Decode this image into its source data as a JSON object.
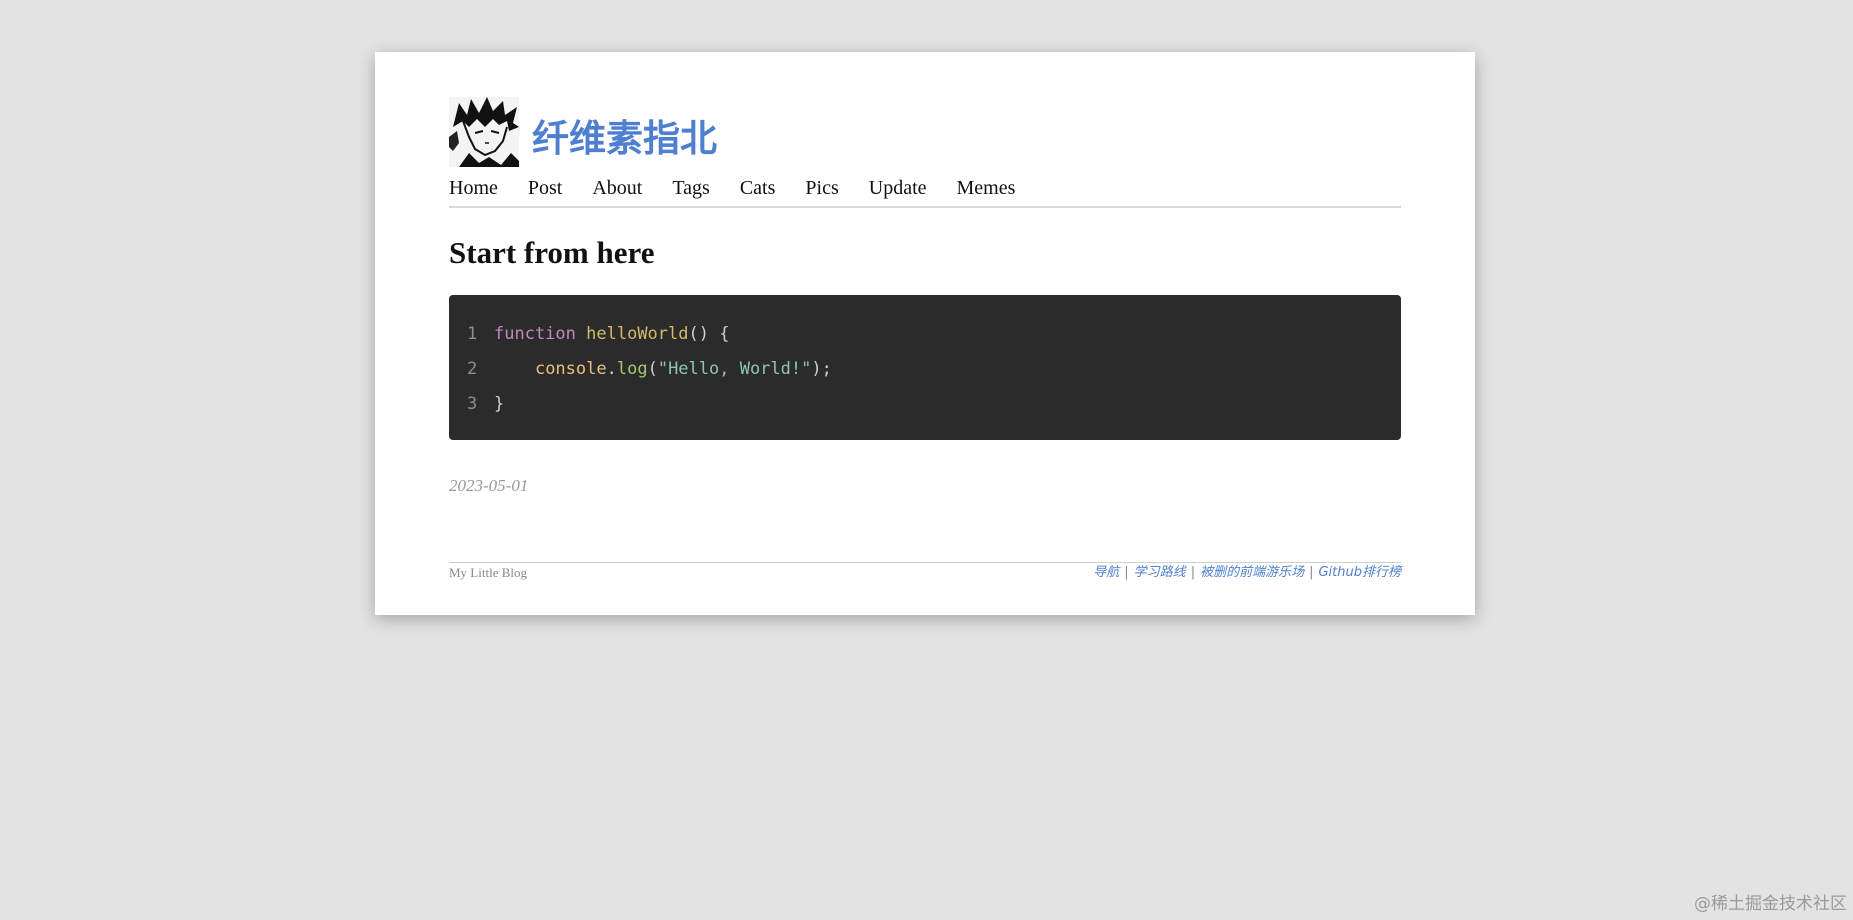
{
  "header": {
    "site_title": "纤维素指北",
    "avatar_icon": "manga-avatar-icon"
  },
  "nav": {
    "items": [
      {
        "label": "Home"
      },
      {
        "label": "Post"
      },
      {
        "label": "About"
      },
      {
        "label": "Tags"
      },
      {
        "label": "Cats"
      },
      {
        "label": "Pics"
      },
      {
        "label": "Update"
      },
      {
        "label": "Memes"
      }
    ]
  },
  "post": {
    "title": "Start from here",
    "date": "2023-05-01",
    "code": {
      "line_numbers": [
        "1",
        "2",
        "3"
      ],
      "line1": {
        "kw": "function",
        "fn": "helloWorld",
        "rest": "() {"
      },
      "line2": {
        "indent": "    ",
        "obj": "console",
        "dot": ".",
        "meth": "log",
        "open": "(",
        "str": "\"Hello, World!\"",
        "close": ");"
      },
      "line3": {
        "text": "}"
      }
    }
  },
  "footer": {
    "left": "My Little Blog",
    "links": [
      {
        "label": "导航"
      },
      {
        "label": "学习路线"
      },
      {
        "label": "被删的前端游乐场"
      },
      {
        "label": "Github排行榜"
      }
    ],
    "separator": "|"
  },
  "watermark": "@稀土掘金技术社区",
  "colors": {
    "page_bg": "#e3e3e3",
    "card_bg": "#ffffff",
    "accent": "#4e7fd0",
    "code_bg": "#2b2b2b"
  }
}
